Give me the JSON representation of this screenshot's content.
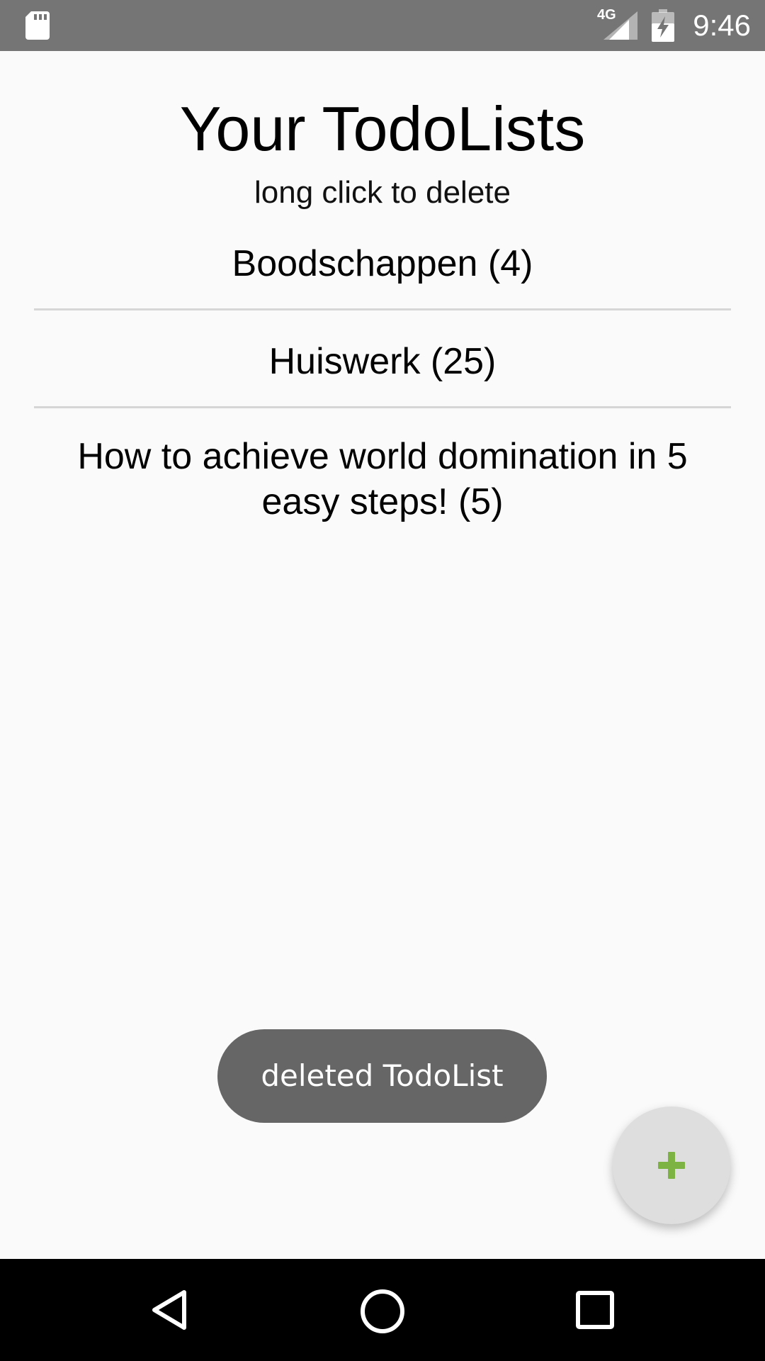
{
  "status_bar": {
    "network": "4G",
    "time": "9:46",
    "icons": [
      "sd-card-icon",
      "signal-icon",
      "battery-charging-icon"
    ]
  },
  "header": {
    "title": "Your TodoLists",
    "subtitle": "long click to delete"
  },
  "lists": [
    {
      "label": "Boodschappen (4)"
    },
    {
      "label": "Huiswerk (25)"
    },
    {
      "label": "How to achieve world domination in 5 easy steps! (5)"
    }
  ],
  "toast": {
    "message": "deleted TodoList"
  },
  "fab": {
    "icon": "plus-icon",
    "color": "#7cb342"
  },
  "nav_bar": {
    "icons": [
      "back-icon",
      "home-icon",
      "recents-icon"
    ]
  },
  "colors": {
    "status_bar": "#757575",
    "background": "#fafafa",
    "divider": "#d6d6d6",
    "toast": "#666666",
    "fab_bg": "#dedede",
    "nav_bar": "#000000"
  }
}
